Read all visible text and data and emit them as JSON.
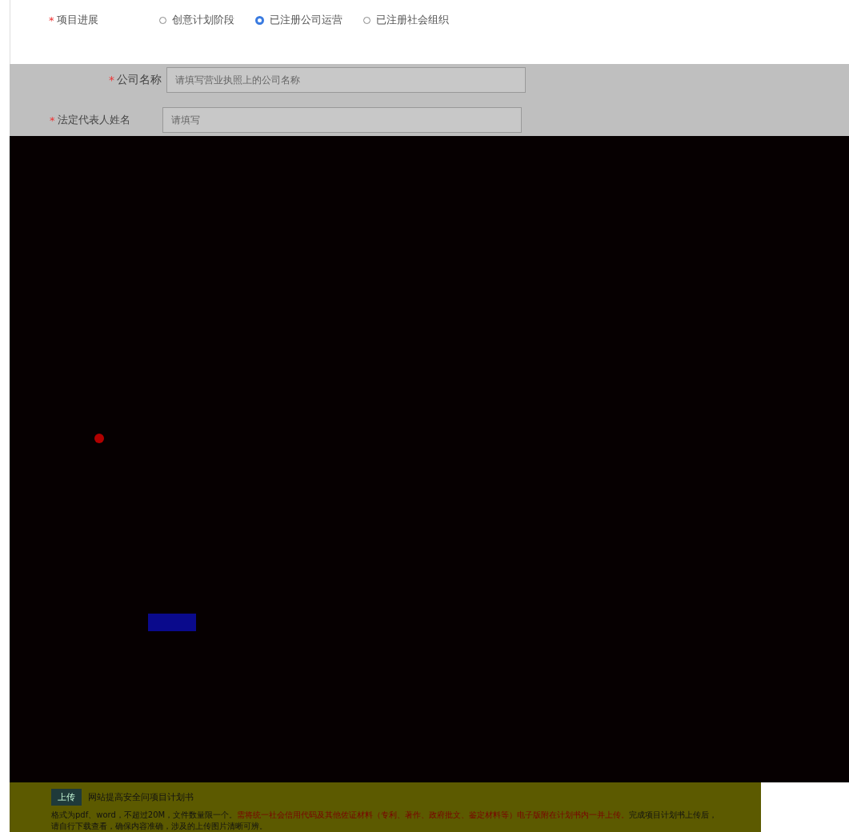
{
  "project_progress": {
    "required_mark": "*",
    "label": "项目进展",
    "options": [
      {
        "label": "创意计划阶段",
        "selected": false
      },
      {
        "label": "已注册公司运营",
        "selected": true
      },
      {
        "label": "已注册社会组织",
        "selected": false
      }
    ]
  },
  "company_fields": [
    {
      "required_mark": "*",
      "label": "公司名称",
      "placeholder": "请填写营业执照上的公司名称"
    },
    {
      "required_mark": "*",
      "label": "法定代表人姓名",
      "placeholder": "请填写"
    }
  ],
  "upload": {
    "button": "上传",
    "file_name": "网站提高安全问项目计划书",
    "note": [
      {
        "text": "格式为pdf、word，不超过20M，文件数量限一个。",
        "highlight": false
      },
      {
        "text": "需将统一社会信用代码及其他佐证材料（专利、著作、政府批文、鉴定材料等）电子版附在计划书内一并上传。",
        "highlight": true
      },
      {
        "text": "完成项目计划书上传后，请自行下载查看，确保内容准确，涉及的上传图片清晰可辨。",
        "highlight": false
      }
    ]
  }
}
